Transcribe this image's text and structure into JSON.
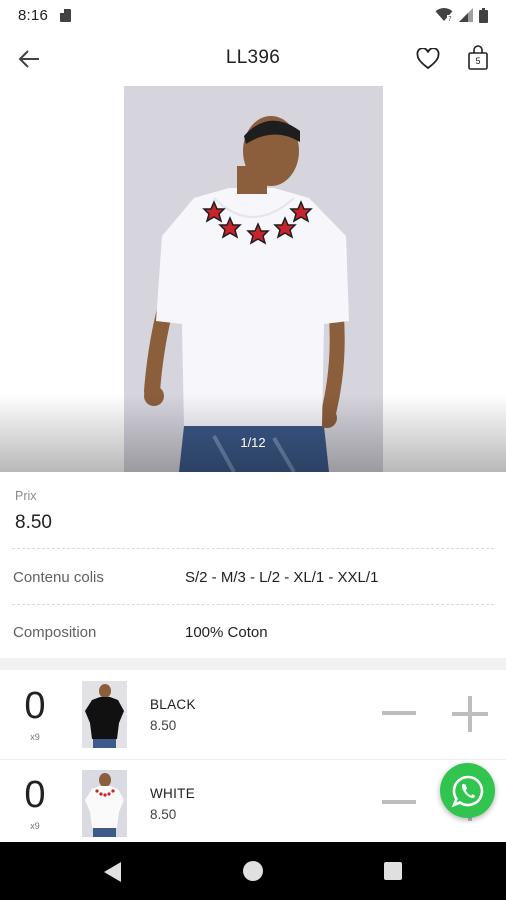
{
  "status_bar": {
    "time": "8:16",
    "icons": [
      "sd-card-icon",
      "wifi-icon",
      "signal-icon",
      "battery-icon"
    ]
  },
  "app_bar": {
    "title": "LL396",
    "back_icon": "arrow-left-icon",
    "favorite_icon": "heart-icon",
    "cart_icon": "shopping-bag-icon",
    "cart_count": "5"
  },
  "gallery": {
    "page_indicator": "1/12",
    "image": "model-white-tshirt-red-stars"
  },
  "details": {
    "price_label": "Prix",
    "price_value": "8.50",
    "rows": [
      {
        "label": "Contenu colis",
        "value": "S/2 - M/3 - L/2 - XL/1 - XXL/1"
      },
      {
        "label": "Composition",
        "value": "100% Coton"
      }
    ]
  },
  "variants": [
    {
      "quantity": "0",
      "unit": "x9",
      "color": "BLACK",
      "price": "8.50",
      "thumb": "black-tshirt-thumbnail"
    },
    {
      "quantity": "0",
      "unit": "x9",
      "color": "WHITE",
      "price": "8.50",
      "thumb": "white-tshirt-thumbnail"
    }
  ],
  "fab": {
    "icon": "whatsapp-icon"
  },
  "nav_bar": {
    "icons": [
      "nav-back-icon",
      "nav-home-icon",
      "nav-recents-icon"
    ]
  },
  "colors": {
    "background": "#ffffff",
    "text": "#212121",
    "muted": "#8a8a8a",
    "whatsapp_green": "#31c44f",
    "stepper_gray": "#bdbdbd",
    "nav_bar": "#000000"
  }
}
